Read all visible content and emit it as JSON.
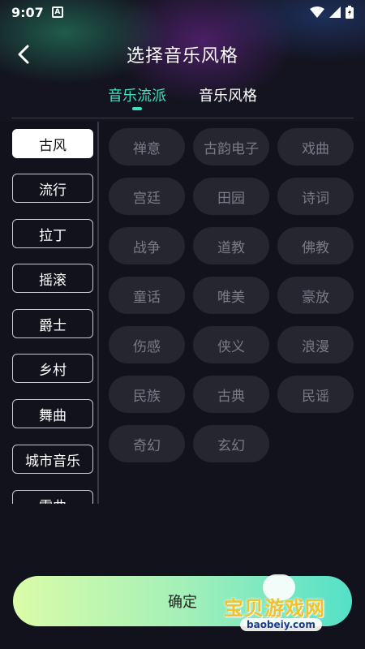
{
  "status_bar": {
    "time": "9:07",
    "notification_icon": "A"
  },
  "header": {
    "title": "选择音乐风格",
    "back_icon": "chevron-left-icon"
  },
  "tabs": [
    {
      "label": "音乐流派",
      "active": true
    },
    {
      "label": "音乐风格",
      "active": false
    }
  ],
  "sidebar": {
    "items": [
      {
        "label": "古风",
        "selected": true
      },
      {
        "label": "流行",
        "selected": false
      },
      {
        "label": "拉丁",
        "selected": false
      },
      {
        "label": "摇滚",
        "selected": false
      },
      {
        "label": "爵士",
        "selected": false
      },
      {
        "label": "乡村",
        "selected": false
      },
      {
        "label": "舞曲",
        "selected": false
      },
      {
        "label": "城市音乐",
        "selected": false
      },
      {
        "label": "雷曲",
        "selected": false
      }
    ]
  },
  "tags": [
    "禅意",
    "古韵电子",
    "戏曲",
    "宫廷",
    "田园",
    "诗词",
    "战争",
    "道教",
    "佛教",
    "童话",
    "唯美",
    "豪放",
    "伤感",
    "侠义",
    "浪漫",
    "民族",
    "古典",
    "民谣",
    "奇幻",
    "玄幻"
  ],
  "confirm": {
    "label": "确定"
  },
  "watermark": {
    "text": "宝贝游戏网",
    "url": "baobeiy.com"
  },
  "colors": {
    "accent": "#3fe0c0",
    "background": "#12121c",
    "tag_bg": "#262631",
    "tag_text": "#7b7b88"
  }
}
